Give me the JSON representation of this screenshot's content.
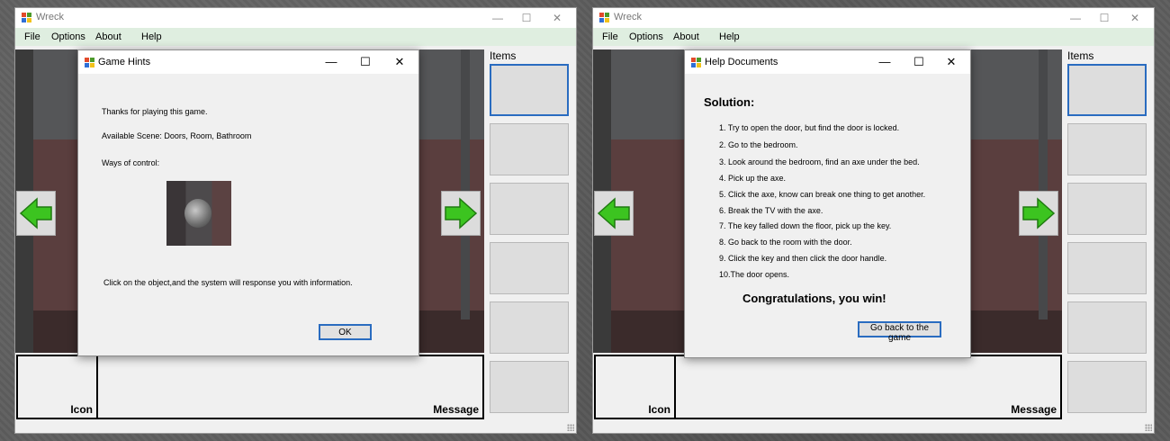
{
  "left": {
    "app": {
      "title": "Wreck",
      "minimize": "—",
      "maximize": "☐",
      "close": "✕",
      "menu": [
        "File",
        "Options",
        "About",
        "Help"
      ],
      "items_label": "Items",
      "icon_label": "Icon",
      "message_label": "Message"
    },
    "dialog": {
      "title": "Game Hints",
      "minimize": "—",
      "maximize": "☐",
      "close": "✕",
      "line1": "Thanks for playing this game.",
      "line2": "Available Scene: Doors, Room, Bathroom",
      "line3": "Ways of control:",
      "line4": "Click on the object,and the system will response you with information.",
      "ok": "OK"
    }
  },
  "right": {
    "app": {
      "title": "Wreck",
      "minimize": "—",
      "maximize": "☐",
      "close": "✕",
      "menu": [
        "File",
        "Options",
        "About",
        "Help"
      ],
      "items_label": "Items",
      "icon_label": "Icon",
      "message_label": "Message"
    },
    "dialog": {
      "title": "Help Documents",
      "minimize": "—",
      "maximize": "☐",
      "close": "✕",
      "heading": "Solution:",
      "steps": [
        "1. Try to open the door, but find the door is locked.",
        "2. Go to the bedroom.",
        "3. Look around the bedroom, find an axe under the bed.",
        "4. Pick up the axe.",
        "5. Click the axe, know can break one thing to get another.",
        "6. Break the TV with the axe.",
        "7. The key falled down the floor, pick up the key.",
        "8. Go back to the room with the door.",
        "9. Click the key and then click the door handle.",
        "10.The door opens."
      ],
      "congrats": "Congratulations, you win!",
      "back_button": "Go back to the game"
    }
  },
  "colors": {
    "menubar": "#dfeee0",
    "accent_border": "#2a6cc0",
    "arrow_green": "#3cc420"
  },
  "icons": [
    "app-logo-icon",
    "left-arrow-icon",
    "right-arrow-icon",
    "door-handle-icon"
  ]
}
